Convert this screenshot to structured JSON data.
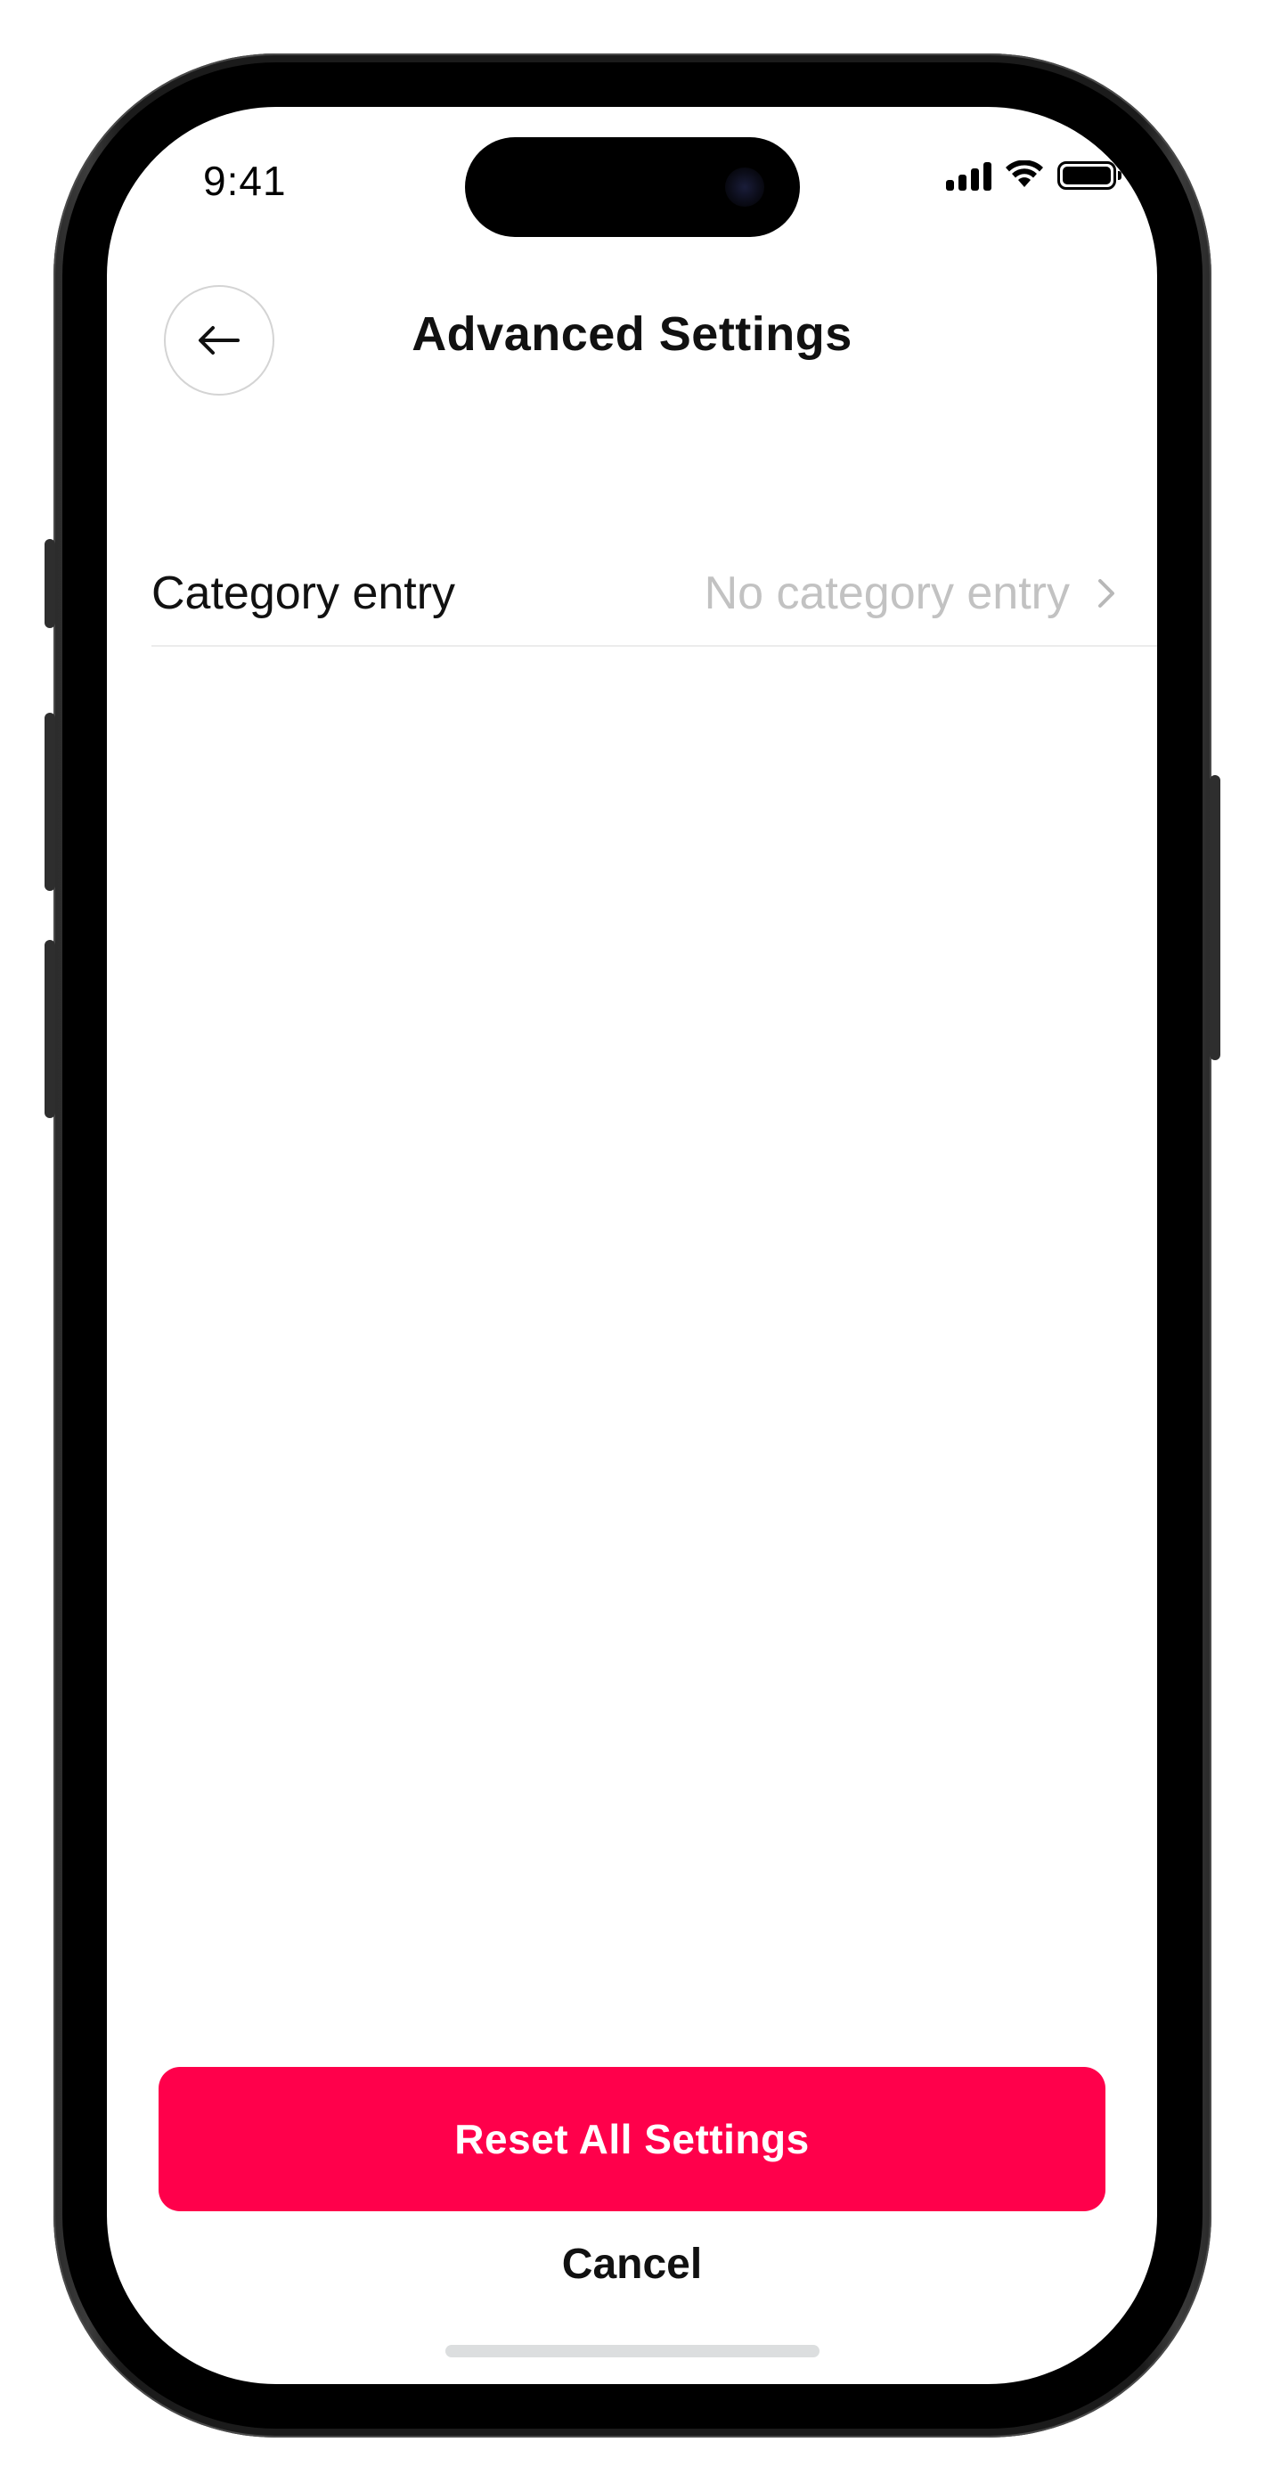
{
  "status_bar": {
    "time": "9:41",
    "icons": [
      "cellular-signal-icon",
      "wifi-icon",
      "battery-icon"
    ]
  },
  "header": {
    "title": "Advanced Settings",
    "back_icon": "arrow-left-icon"
  },
  "settings": {
    "rows": [
      {
        "label": "Category entry",
        "value": "No category entry",
        "icon": "chevron-right-icon"
      }
    ]
  },
  "actions": {
    "reset_label": "Reset All Settings",
    "cancel_label": "Cancel"
  },
  "colors": {
    "accent": "#ff004b",
    "text_primary": "#111111",
    "text_muted": "#c2c2c2",
    "divider": "#ececec"
  }
}
